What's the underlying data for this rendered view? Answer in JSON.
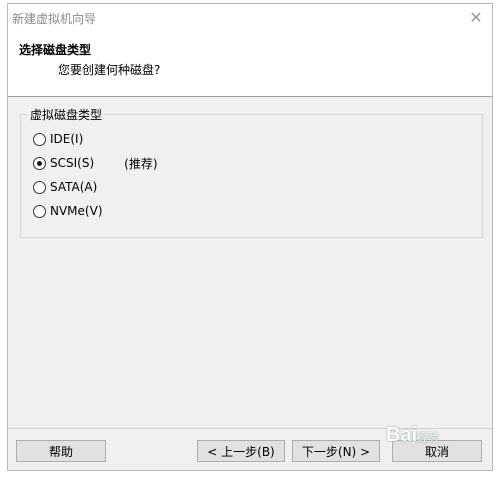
{
  "window": {
    "title": "新建虚拟机向导",
    "close_glyph": "✕"
  },
  "header": {
    "title": "选择磁盘类型",
    "subtitle": "您要创建何种磁盘?"
  },
  "group": {
    "label": "虚拟磁盘类型",
    "options": [
      {
        "label": "IDE(I)",
        "selected": false,
        "note": ""
      },
      {
        "label": "SCSI(S)",
        "selected": true,
        "note": "(推荐)"
      },
      {
        "label": "SATA(A)",
        "selected": false,
        "note": ""
      },
      {
        "label": "NVMe(V)",
        "selected": false,
        "note": ""
      }
    ]
  },
  "buttons": {
    "help": "帮助",
    "back": "< 上一步(B)",
    "next": "下一步(N) >",
    "cancel": "取消"
  },
  "watermark": {
    "text": "Bai",
    "suffix": "经验"
  }
}
